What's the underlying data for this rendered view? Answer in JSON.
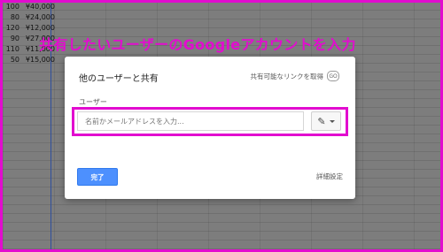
{
  "background_rows": [
    {
      "num": "100",
      "val": "¥40,000"
    },
    {
      "num": "80",
      "val": "¥24,000"
    },
    {
      "num": "120",
      "val": "¥12,000"
    },
    {
      "num": "90",
      "val": "¥27,000"
    },
    {
      "num": "110",
      "val": "¥11,000"
    },
    {
      "num": "50",
      "val": "¥15,000"
    }
  ],
  "overlay_title": "共有したいユーザーのGoogleアカウントを入力",
  "dialog": {
    "title": "他のユーザーと共有",
    "link_share_label": "共有可能なリンクを取得",
    "link_icon": "GO",
    "users_label": "ユーザー",
    "input_placeholder": "名前かメールアドレスを入力...",
    "permission_icon": "pencil-icon",
    "done_label": "完了",
    "advanced_label": "詳細設定"
  },
  "colors": {
    "highlight": "#e20ccf",
    "primary_button": "#4d90fe"
  }
}
